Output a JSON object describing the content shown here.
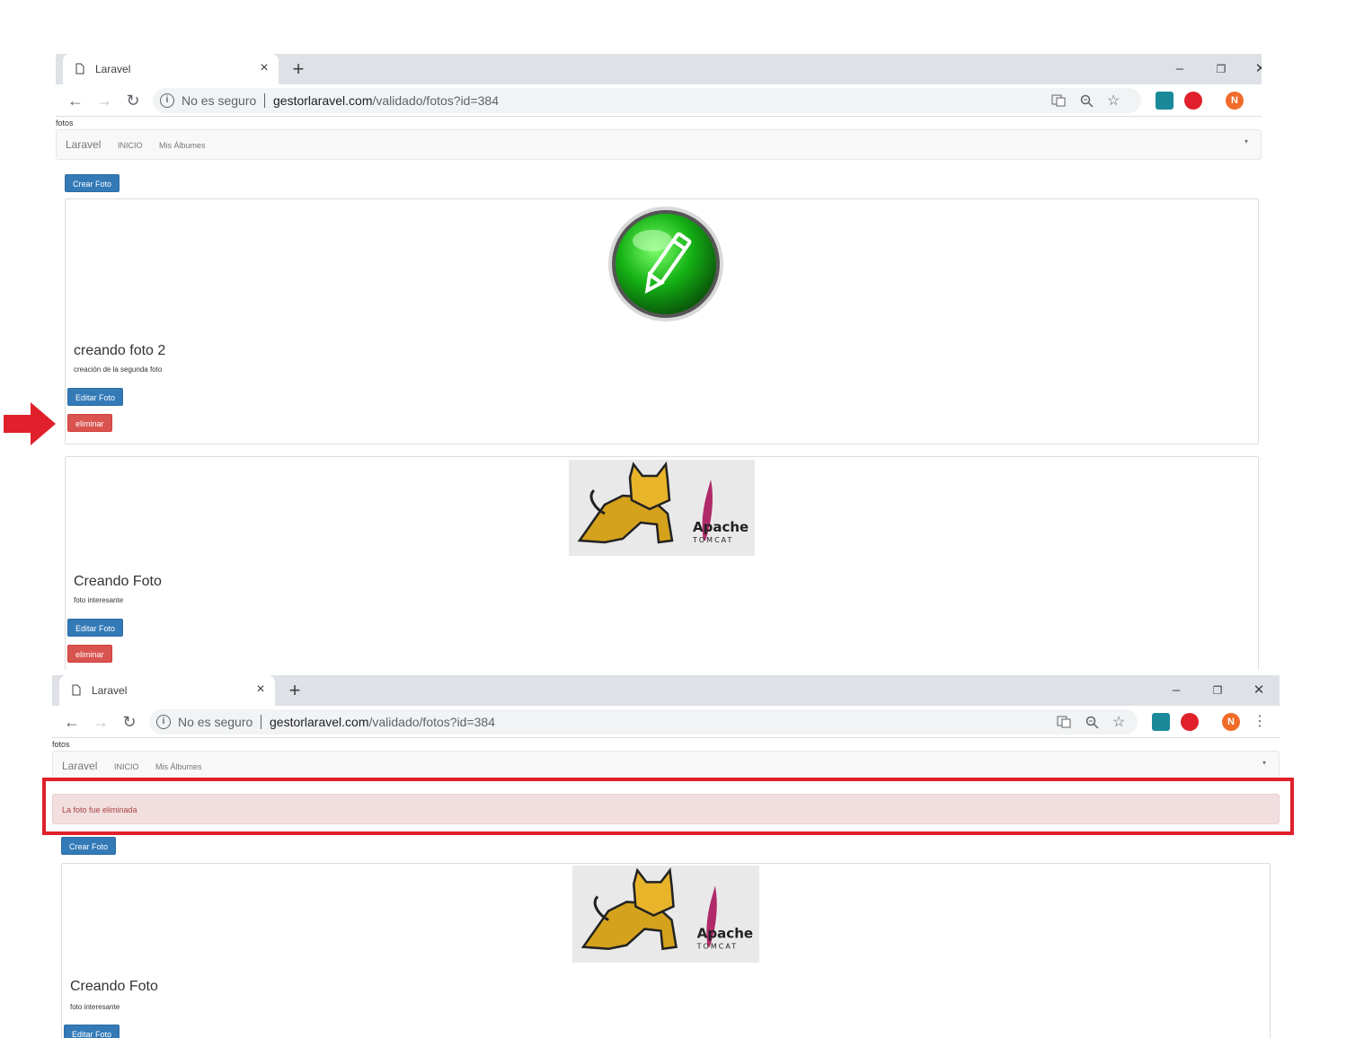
{
  "screens": [
    {
      "tab_title": "Laravel",
      "tab_close": "×",
      "new_tab": "+",
      "window_controls": {
        "minimize": "–",
        "maximize": "❐",
        "close": "✕"
      },
      "nav": {
        "back": "←",
        "forward": "→",
        "reload": "↻"
      },
      "omnibox": {
        "info": "i",
        "security": "No es seguro",
        "host": "gestorlaravel.com",
        "path": "/validado/fotos?id=384"
      },
      "profile_initial": "N",
      "page_label": "fotos",
      "navbar": {
        "brand": "Laravel",
        "links": [
          "INICIO",
          "Mis Álbumes"
        ]
      },
      "create_button": "Crear Foto",
      "photos": [
        {
          "title": "creando foto 2",
          "description": "creación de la segunda foto",
          "edit": "Editar Foto",
          "delete": "eliminar",
          "image_icon": "green-pencil-icon"
        },
        {
          "title": "Creando Foto",
          "description": "foto interesante",
          "edit": "Editar Foto",
          "delete": "eliminar",
          "image_icon": "apache-tomcat-logo",
          "logo_text": "Apache",
          "logo_sub": "TOMCAT"
        }
      ]
    },
    {
      "tab_title": "Laravel",
      "tab_close": "×",
      "new_tab": "+",
      "window_controls": {
        "minimize": "–",
        "maximize": "❐",
        "close": "✕"
      },
      "nav": {
        "back": "←",
        "forward": "→",
        "reload": "↻"
      },
      "omnibox": {
        "info": "i",
        "security": "No es seguro",
        "host": "gestorlaravel.com",
        "path": "/validado/fotos?id=384"
      },
      "profile_initial": "N",
      "page_label": "fotos",
      "navbar": {
        "brand": "Laravel",
        "links": [
          "INICIO",
          "Mis Álbumes"
        ]
      },
      "alert": "La foto fue eliminada",
      "create_button": "Crear Foto",
      "photos": [
        {
          "title": "Creando Foto",
          "description": "foto interesante",
          "edit": "Editar Foto",
          "image_icon": "apache-tomcat-logo",
          "logo_text": "Apache",
          "logo_sub": "TOMCAT"
        }
      ]
    }
  ],
  "colors": {
    "primary": "#337ab7",
    "danger": "#d9534f",
    "alert_bg": "#f2dede",
    "annotation_red": "#e0202a"
  }
}
